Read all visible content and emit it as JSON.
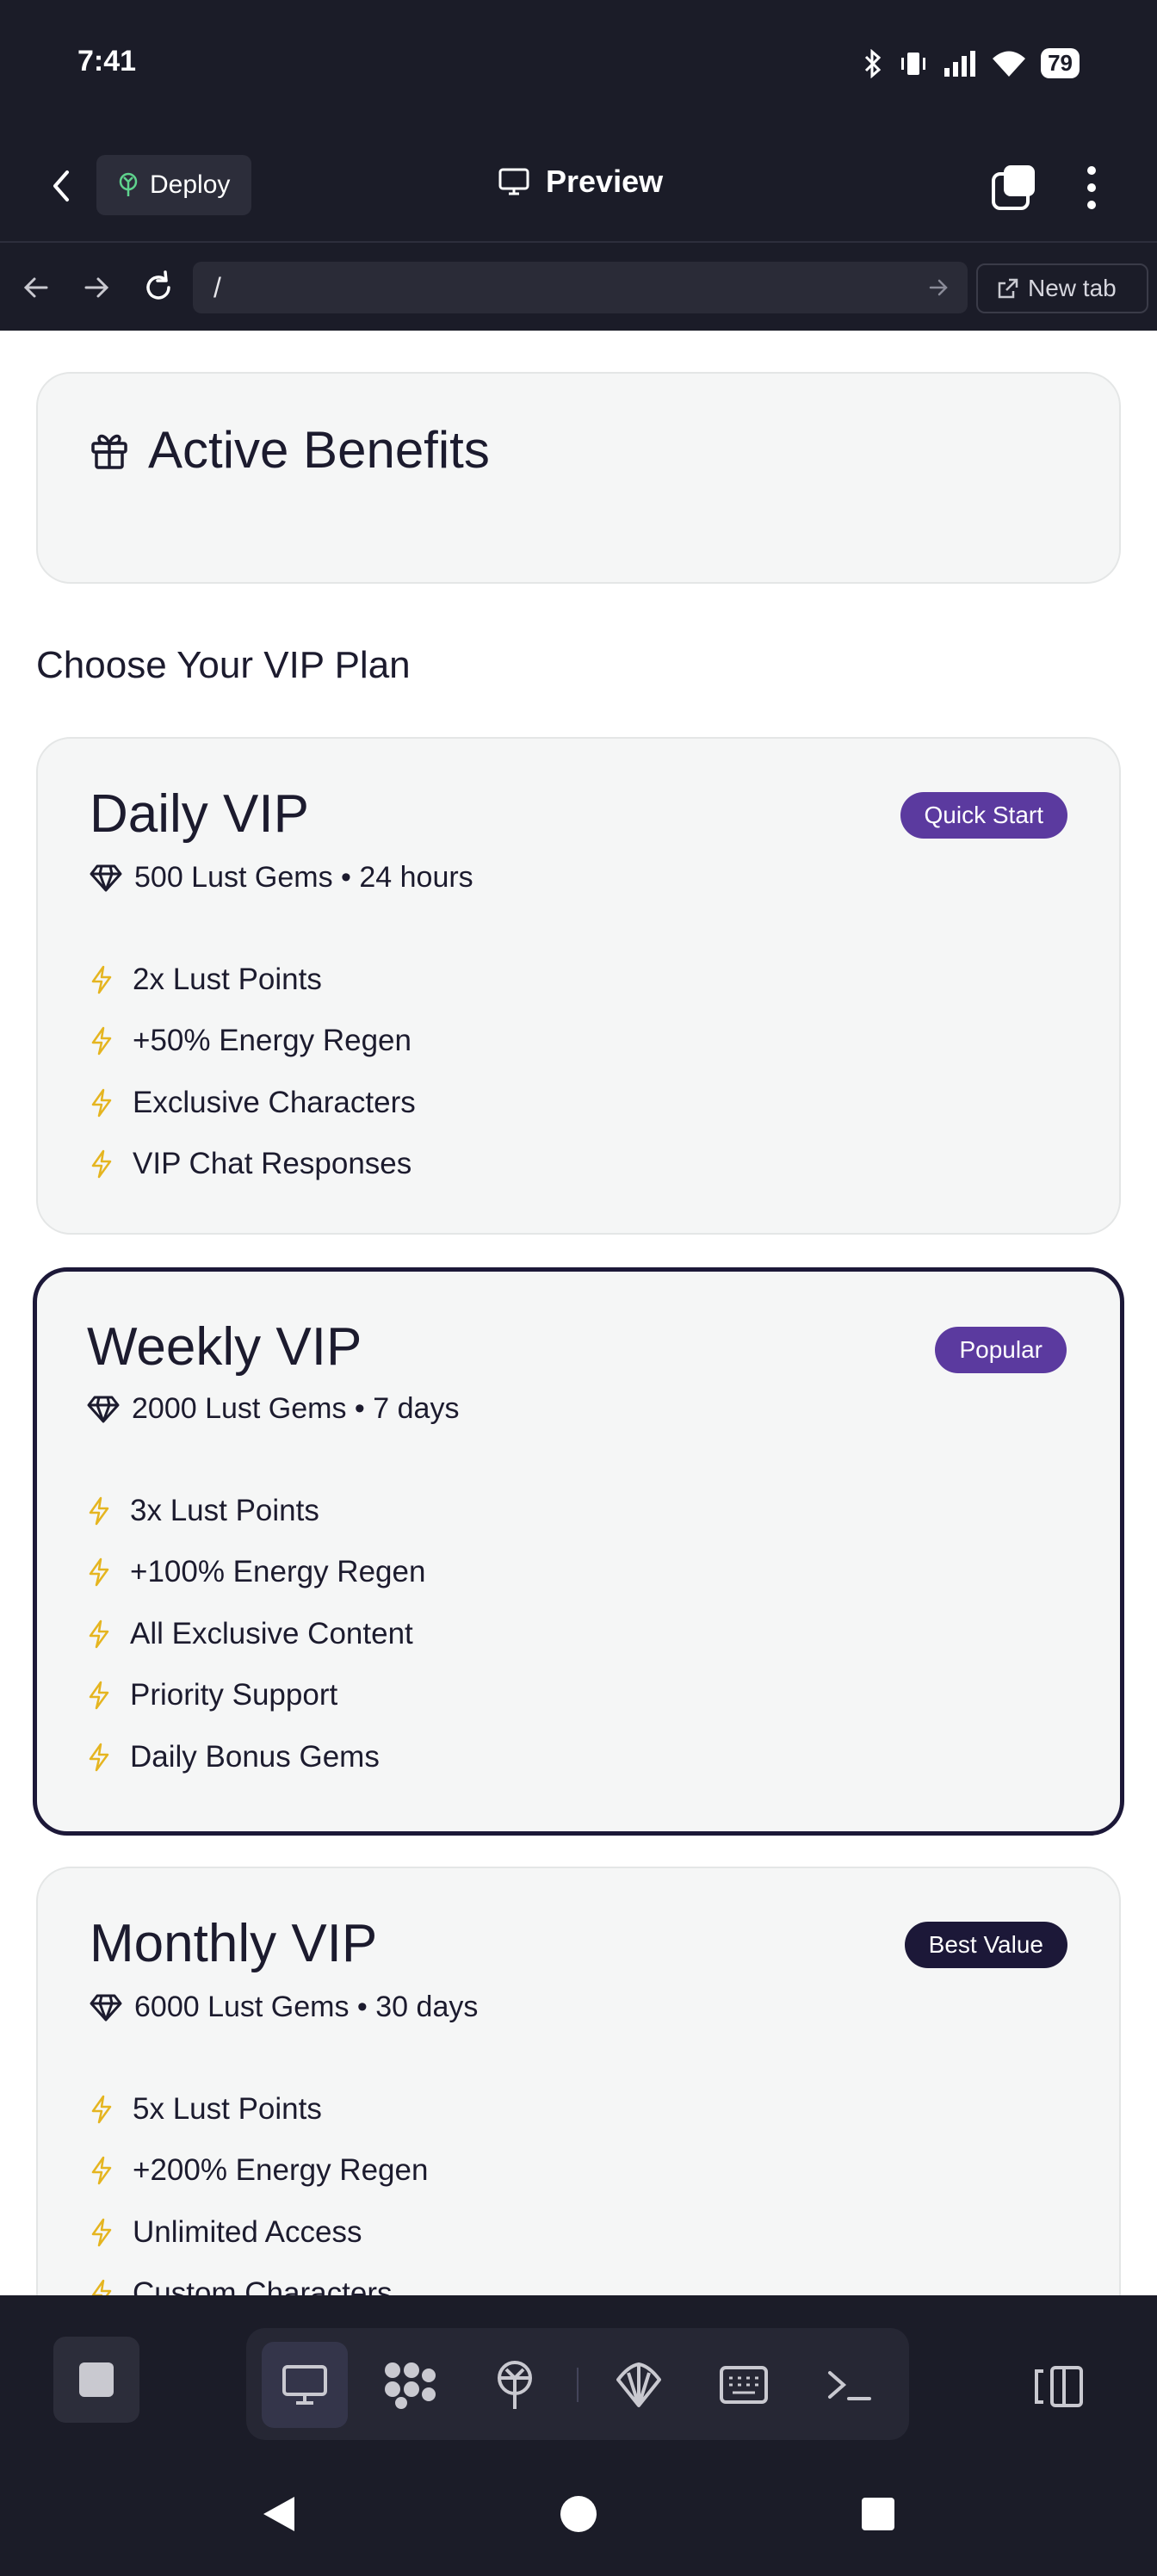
{
  "status_bar": {
    "time": "7:41",
    "battery": "79"
  },
  "header": {
    "deploy_label": "Deploy",
    "title": "Preview"
  },
  "url_bar": {
    "url": "/",
    "new_tab_label": "New tab"
  },
  "benefits": {
    "title": "Active Benefits"
  },
  "section_title": "Choose Your VIP Plan",
  "plans": [
    {
      "title": "Daily VIP",
      "badge": "Quick Start",
      "meta": "500 Lust Gems • 24 hours",
      "features": [
        "2x Lust Points",
        "+50% Energy Regen",
        "Exclusive Characters",
        "VIP Chat Responses"
      ]
    },
    {
      "title": "Weekly VIP",
      "badge": "Popular",
      "meta": "2000 Lust Gems • 7 days",
      "features": [
        "3x Lust Points",
        "+100% Energy Regen",
        "All Exclusive Content",
        "Priority Support",
        "Daily Bonus Gems"
      ]
    },
    {
      "title": "Monthly VIP",
      "badge": "Best Value",
      "meta": "6000 Lust Gems • 30 days",
      "features": [
        "5x Lust Points",
        "+200% Energy Regen",
        "Unlimited Access",
        "Custom Characters"
      ]
    }
  ],
  "colors": {
    "accent_purple": "#5b3a9f",
    "dark_navy": "#1c1838",
    "bolt_yellow": "#e5b520",
    "chrome_bg": "#1b1c28"
  }
}
